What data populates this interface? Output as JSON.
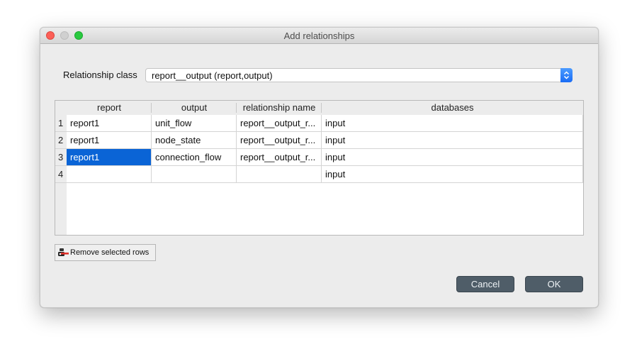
{
  "window": {
    "title": "Add relationships",
    "controls": [
      "close",
      "minimize",
      "maximize"
    ]
  },
  "relationship_class": {
    "label": "Relationship class",
    "selected": "report__output (report,output)"
  },
  "table": {
    "columns": [
      "report",
      "output",
      "relationship name",
      "databases"
    ],
    "rows": [
      {
        "num": "1",
        "cells": [
          "report1",
          "unit_flow",
          "report__output_r...",
          "input"
        ]
      },
      {
        "num": "2",
        "cells": [
          "report1",
          "node_state",
          "report__output_r...",
          "input"
        ]
      },
      {
        "num": "3",
        "cells": [
          "report1",
          "connection_flow",
          "report__output_r...",
          "input"
        ],
        "selected_col": 0
      },
      {
        "num": "4",
        "cells": [
          "",
          "",
          "",
          "input"
        ]
      }
    ]
  },
  "buttons": {
    "remove_rows": "Remove selected rows",
    "remove_rows_icon": "remove-rows-icon",
    "cancel": "Cancel",
    "ok": "OK"
  },
  "colors": {
    "selection": "#0a64d6",
    "dialog_button": "#4f5d68",
    "combo_accent": "#1a6cf5"
  }
}
